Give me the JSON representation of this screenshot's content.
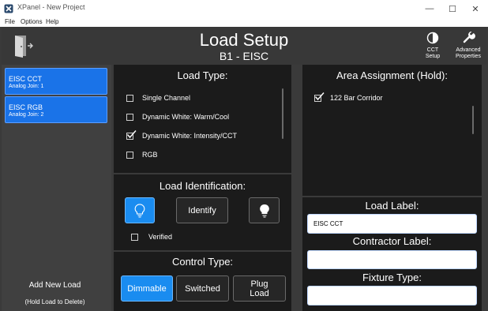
{
  "window": {
    "title": "XPanel - New Project",
    "minimize_glyph": "—",
    "maximize_glyph": "☐",
    "close_glyph": "✕"
  },
  "menu": [
    "File",
    "Options",
    "Help"
  ],
  "header": {
    "title": "Load Setup",
    "subtitle": "B1 - EISC",
    "cct_setup_label": [
      "CCT",
      "Setup"
    ],
    "advanced_label": [
      "Advanced",
      "Properties"
    ]
  },
  "loads": [
    {
      "name": "EISC CCT",
      "join": "Analog Join: 1"
    },
    {
      "name": "EISC RGB",
      "join": "Analog Join: 2"
    }
  ],
  "left_footer": {
    "add_label": "Add New Load",
    "hint": "(Hold Load to Delete)"
  },
  "load_type": {
    "title": "Load Type:",
    "options": [
      {
        "label": "Single Channel",
        "checked": false
      },
      {
        "label": "Dynamic White: Warm/Cool",
        "checked": false
      },
      {
        "label": "Dynamic White: Intensity/CCT",
        "checked": true
      },
      {
        "label": "RGB",
        "checked": false
      }
    ]
  },
  "load_identification": {
    "title": "Load Identification:",
    "identify_label": "Identify",
    "verified_label": "Verified",
    "verified_checked": false
  },
  "control_type": {
    "title": "Control Type:",
    "options": [
      "Dimmable",
      "Switched",
      "Plug Load"
    ],
    "selected": "Dimmable"
  },
  "area_assignment": {
    "title": "Area Assignment (Hold):",
    "areas": [
      {
        "label": "122 Bar Corridor",
        "checked": true
      }
    ]
  },
  "fields": {
    "load_label_title": "Load Label:",
    "load_label_value": "EISC CCT",
    "contractor_label_title": "Contractor Label:",
    "contractor_label_value": "",
    "fixture_type_title": "Fixture Type:",
    "fixture_type_value": ""
  },
  "colors": {
    "accent": "#1a8cf0",
    "panel": "#1b1b1b",
    "background": "#3a3a3a"
  }
}
